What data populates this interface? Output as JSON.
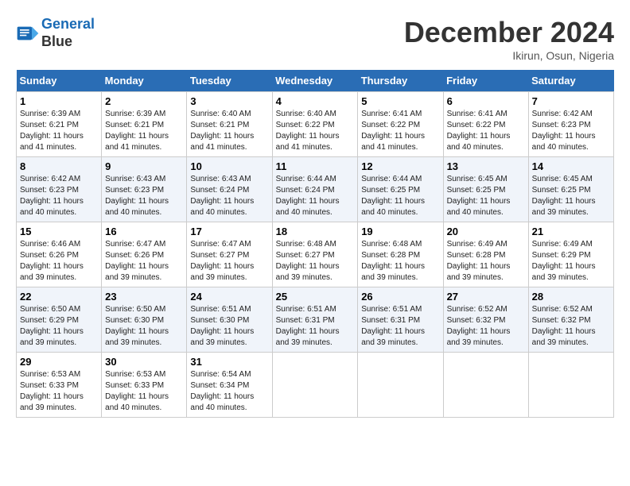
{
  "header": {
    "logo_line1": "General",
    "logo_line2": "Blue",
    "month_title": "December 2024",
    "location": "Ikirun, Osun, Nigeria"
  },
  "weekdays": [
    "Sunday",
    "Monday",
    "Tuesday",
    "Wednesday",
    "Thursday",
    "Friday",
    "Saturday"
  ],
  "weeks": [
    [
      {
        "day": "1",
        "sunrise": "6:39 AM",
        "sunset": "6:21 PM",
        "daylight": "11 hours and 41 minutes."
      },
      {
        "day": "2",
        "sunrise": "6:39 AM",
        "sunset": "6:21 PM",
        "daylight": "11 hours and 41 minutes."
      },
      {
        "day": "3",
        "sunrise": "6:40 AM",
        "sunset": "6:21 PM",
        "daylight": "11 hours and 41 minutes."
      },
      {
        "day": "4",
        "sunrise": "6:40 AM",
        "sunset": "6:22 PM",
        "daylight": "11 hours and 41 minutes."
      },
      {
        "day": "5",
        "sunrise": "6:41 AM",
        "sunset": "6:22 PM",
        "daylight": "11 hours and 41 minutes."
      },
      {
        "day": "6",
        "sunrise": "6:41 AM",
        "sunset": "6:22 PM",
        "daylight": "11 hours and 40 minutes."
      },
      {
        "day": "7",
        "sunrise": "6:42 AM",
        "sunset": "6:23 PM",
        "daylight": "11 hours and 40 minutes."
      }
    ],
    [
      {
        "day": "8",
        "sunrise": "6:42 AM",
        "sunset": "6:23 PM",
        "daylight": "11 hours and 40 minutes."
      },
      {
        "day": "9",
        "sunrise": "6:43 AM",
        "sunset": "6:23 PM",
        "daylight": "11 hours and 40 minutes."
      },
      {
        "day": "10",
        "sunrise": "6:43 AM",
        "sunset": "6:24 PM",
        "daylight": "11 hours and 40 minutes."
      },
      {
        "day": "11",
        "sunrise": "6:44 AM",
        "sunset": "6:24 PM",
        "daylight": "11 hours and 40 minutes."
      },
      {
        "day": "12",
        "sunrise": "6:44 AM",
        "sunset": "6:25 PM",
        "daylight": "11 hours and 40 minutes."
      },
      {
        "day": "13",
        "sunrise": "6:45 AM",
        "sunset": "6:25 PM",
        "daylight": "11 hours and 40 minutes."
      },
      {
        "day": "14",
        "sunrise": "6:45 AM",
        "sunset": "6:25 PM",
        "daylight": "11 hours and 39 minutes."
      }
    ],
    [
      {
        "day": "15",
        "sunrise": "6:46 AM",
        "sunset": "6:26 PM",
        "daylight": "11 hours and 39 minutes."
      },
      {
        "day": "16",
        "sunrise": "6:47 AM",
        "sunset": "6:26 PM",
        "daylight": "11 hours and 39 minutes."
      },
      {
        "day": "17",
        "sunrise": "6:47 AM",
        "sunset": "6:27 PM",
        "daylight": "11 hours and 39 minutes."
      },
      {
        "day": "18",
        "sunrise": "6:48 AM",
        "sunset": "6:27 PM",
        "daylight": "11 hours and 39 minutes."
      },
      {
        "day": "19",
        "sunrise": "6:48 AM",
        "sunset": "6:28 PM",
        "daylight": "11 hours and 39 minutes."
      },
      {
        "day": "20",
        "sunrise": "6:49 AM",
        "sunset": "6:28 PM",
        "daylight": "11 hours and 39 minutes."
      },
      {
        "day": "21",
        "sunrise": "6:49 AM",
        "sunset": "6:29 PM",
        "daylight": "11 hours and 39 minutes."
      }
    ],
    [
      {
        "day": "22",
        "sunrise": "6:50 AM",
        "sunset": "6:29 PM",
        "daylight": "11 hours and 39 minutes."
      },
      {
        "day": "23",
        "sunrise": "6:50 AM",
        "sunset": "6:30 PM",
        "daylight": "11 hours and 39 minutes."
      },
      {
        "day": "24",
        "sunrise": "6:51 AM",
        "sunset": "6:30 PM",
        "daylight": "11 hours and 39 minutes."
      },
      {
        "day": "25",
        "sunrise": "6:51 AM",
        "sunset": "6:31 PM",
        "daylight": "11 hours and 39 minutes."
      },
      {
        "day": "26",
        "sunrise": "6:51 AM",
        "sunset": "6:31 PM",
        "daylight": "11 hours and 39 minutes."
      },
      {
        "day": "27",
        "sunrise": "6:52 AM",
        "sunset": "6:32 PM",
        "daylight": "11 hours and 39 minutes."
      },
      {
        "day": "28",
        "sunrise": "6:52 AM",
        "sunset": "6:32 PM",
        "daylight": "11 hours and 39 minutes."
      }
    ],
    [
      {
        "day": "29",
        "sunrise": "6:53 AM",
        "sunset": "6:33 PM",
        "daylight": "11 hours and 39 minutes."
      },
      {
        "day": "30",
        "sunrise": "6:53 AM",
        "sunset": "6:33 PM",
        "daylight": "11 hours and 40 minutes."
      },
      {
        "day": "31",
        "sunrise": "6:54 AM",
        "sunset": "6:34 PM",
        "daylight": "11 hours and 40 minutes."
      },
      null,
      null,
      null,
      null
    ]
  ]
}
